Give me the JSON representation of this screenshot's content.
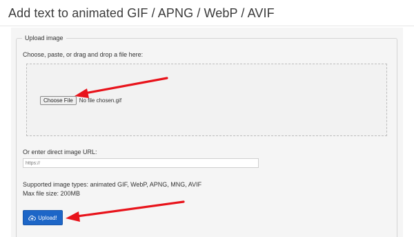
{
  "page": {
    "title": "Add text to animated GIF / APNG / WebP / AVIF"
  },
  "upload_section": {
    "legend": "Upload image",
    "file_prompt": "Choose, paste, or drag and drop a file here:",
    "choose_file_label": "Choose File",
    "file_name": "No file chosen.gif",
    "url_label": "Or enter direct image URL:",
    "url_placeholder": "https://",
    "url_value": "",
    "supported_types": "Supported image types: animated GIF, WebP, APNG, MNG, AVIF",
    "max_size": "Max file size: 200MB",
    "upload_label": "Upload!"
  },
  "icons": {
    "upload": "cloud-upload-icon"
  },
  "colors": {
    "upload_button": "#1d66c7",
    "annotation_arrow": "#e8131b",
    "panel_background": "#f5f5f5",
    "title_text": "#3a3a3a"
  }
}
